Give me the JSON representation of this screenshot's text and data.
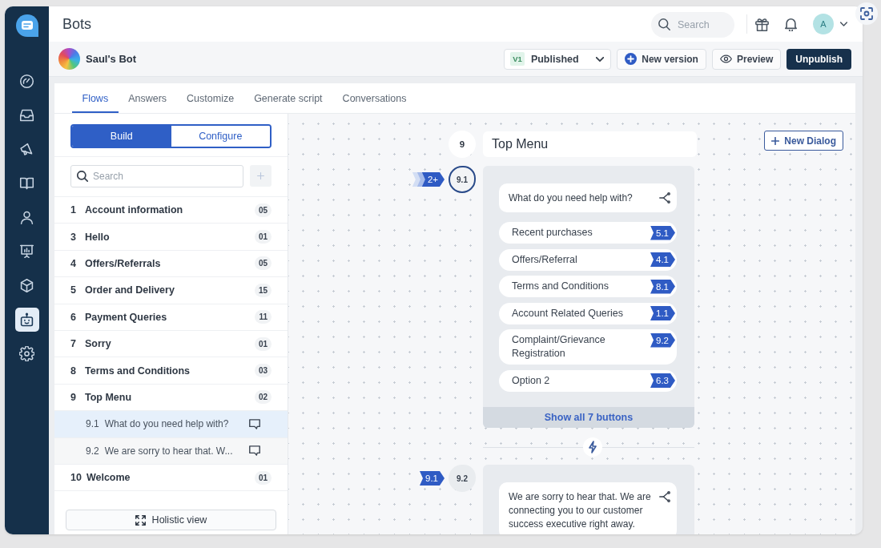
{
  "nav": {
    "items": [
      {
        "selected": false
      },
      {
        "selected": false
      },
      {
        "selected": false
      },
      {
        "selected": false
      },
      {
        "selected": false
      },
      {
        "selected": false
      },
      {
        "selected": false
      },
      {
        "selected": true
      },
      {
        "selected": false
      }
    ]
  },
  "header": {
    "title": "Bots",
    "search": {
      "placeholder": "Search"
    },
    "avatar": {
      "initial": "A"
    }
  },
  "bot_bar": {
    "name": "Saul's Bot",
    "version": {
      "badge": "V1",
      "status": "Published"
    },
    "buttons": [
      {
        "label": "New version",
        "kind": "add"
      },
      {
        "label": "Preview",
        "kind": "view"
      },
      {
        "label": "Unpublish",
        "kind": "primary"
      }
    ]
  },
  "tabs": [
    {
      "label": "Flows",
      "selected": true
    },
    {
      "label": "Answers",
      "selected": false
    },
    {
      "label": "Customize",
      "selected": false
    },
    {
      "label": "Generate script",
      "selected": false
    },
    {
      "label": "Conversations",
      "selected": false
    }
  ],
  "flows_panel": {
    "modes": [
      {
        "label": "Build",
        "selected": true
      },
      {
        "label": "Configure",
        "selected": false
      }
    ],
    "search": {
      "placeholder": "Search"
    },
    "flows": [
      {
        "number": "1",
        "name": "Account information",
        "count": "05",
        "selected": false
      },
      {
        "number": "3",
        "name": "Hello",
        "count": "01",
        "selected": false
      },
      {
        "number": "4",
        "name": "Offers/Referrals",
        "count": "05",
        "selected": false
      },
      {
        "number": "5",
        "name": "Order and Delivery",
        "count": "15",
        "selected": false
      },
      {
        "number": "6",
        "name": "Payment Queries",
        "count": "11",
        "selected": false
      },
      {
        "number": "7",
        "name": "Sorry",
        "count": "01",
        "selected": false
      },
      {
        "number": "8",
        "name": "Terms and Conditions",
        "count": "03",
        "selected": false
      },
      {
        "number": "9",
        "name": "Top Menu",
        "count": "02",
        "selected": false,
        "children": [
          {
            "number": "9.1",
            "name": "What do you need help with?",
            "selected": true
          },
          {
            "number": "9.2",
            "name": "We are sorry to hear that. W...",
            "selected": false
          }
        ]
      },
      {
        "number": "10",
        "name": "Welcome",
        "count": "01",
        "selected": false
      }
    ],
    "holistic_button": "Holistic view"
  },
  "canvas": {
    "new_dialog_button": "New Dialog",
    "node": {
      "number": "9",
      "title": "Top Menu"
    },
    "dialogs": [
      {
        "number": "9.1",
        "selected": true,
        "incoming": {
          "label": "2+",
          "stacked": true
        },
        "message": "What do you need help with?",
        "buttons": [
          {
            "label": "Recent purchases",
            "target": "5.1"
          },
          {
            "label": "Offers/Referral",
            "target": "4.1"
          },
          {
            "label": "Terms and Conditions",
            "target": "8.1"
          },
          {
            "label": "Account Related Queries",
            "target": "1.1"
          },
          {
            "label": "Complaint/Grievance Registration",
            "target": "9.2"
          },
          {
            "label": "Option 2",
            "target": "6.3"
          }
        ],
        "show_all": "Show all 7 buttons"
      },
      {
        "number": "9.2",
        "selected": false,
        "incoming": {
          "label": "9.1",
          "stacked": false
        },
        "message": "We are sorry to hear that. We are connecting you to our customer success executive right away."
      }
    ]
  }
}
